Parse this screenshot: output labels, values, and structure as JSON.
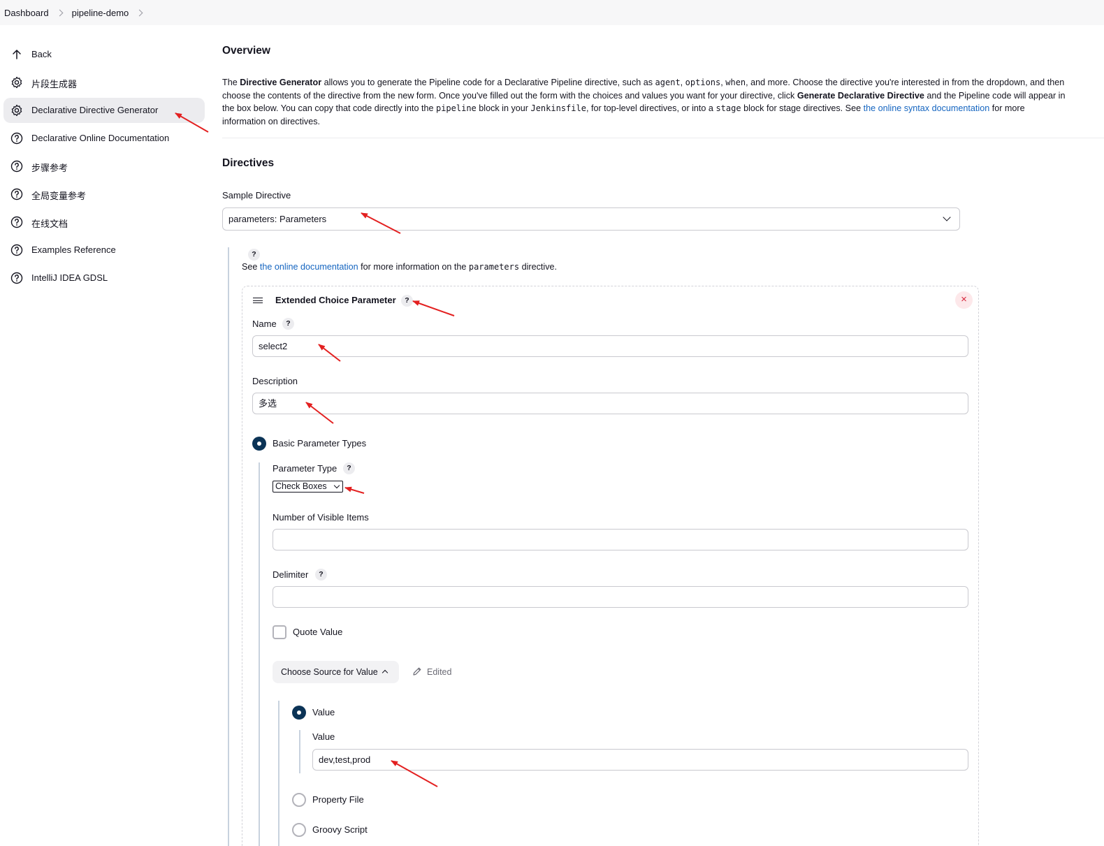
{
  "breadcrumb": {
    "items": [
      "Dashboard",
      "pipeline-demo"
    ]
  },
  "sidebar": {
    "items": [
      {
        "label": "Back",
        "icon": "arrow-up-icon",
        "active": false
      },
      {
        "label": "片段生成器",
        "icon": "gear-icon",
        "active": false
      },
      {
        "label": "Declarative Directive Generator",
        "icon": "gear-icon",
        "active": true
      },
      {
        "label": "Declarative Online Documentation",
        "icon": "help-circle-icon",
        "active": false
      },
      {
        "label": "步骤参考",
        "icon": "help-circle-icon",
        "active": false
      },
      {
        "label": "全局变量参考",
        "icon": "help-circle-icon",
        "active": false
      },
      {
        "label": "在线文档",
        "icon": "help-circle-icon",
        "active": false
      },
      {
        "label": "Examples Reference",
        "icon": "help-circle-icon",
        "active": false
      },
      {
        "label": "IntelliJ IDEA GDSL",
        "icon": "help-circle-icon",
        "active": false
      }
    ]
  },
  "overview": {
    "title": "Overview",
    "line1": {
      "t1": "The ",
      "b1": "Directive Generator",
      "t2": " allows you to generate the Pipeline code for a Declarative Pipeline directive, such as ",
      "c1": "agent",
      "t3": ", ",
      "c2": "options",
      "t4": ", ",
      "c3": "when",
      "t5": ", and more. Choose the directive you're interested in from the dropdown, and then"
    },
    "line2": {
      "t1": "choose the contents of the directive from the new form. Once you've filled out the form with the choices and values you want for your directive, click ",
      "b1": "Generate Declarative Directive",
      "t2": " and the Pipeline code will appear in"
    },
    "line3": {
      "t1": "the box below. You can copy that code directly into the ",
      "c1": "pipeline",
      "t2": " block in your ",
      "c2": "Jenkinsfile",
      "t3": ", for top-level directives, or into a ",
      "c3": "stage",
      "t4": " block for stage directives. See ",
      "link": "the online syntax documentation",
      "t5": " for more"
    },
    "line4": "information on directives."
  },
  "directives": {
    "title": "Directives",
    "sample_label": "Sample Directive",
    "sample_value": "parameters: Parameters",
    "help_glyph": "?",
    "doc_prefix": "See ",
    "doc_link": "the online documentation",
    "doc_middle": " for more information on the ",
    "doc_code": "parameters",
    "doc_suffix": " directive."
  },
  "parameter": {
    "title": "Extended Choice Parameter",
    "close_glyph": "×",
    "name_label": "Name",
    "name_value": "select2",
    "description_label": "Description",
    "description_value": "多选",
    "basic_types_label": "Basic Parameter Types",
    "type_label": "Parameter Type",
    "type_value": "Check Boxes",
    "visible_items_label": "Number of Visible Items",
    "visible_items_value": "",
    "delimiter_label": "Delimiter",
    "delimiter_value": "",
    "quote_value_label": "Quote Value",
    "quote_value_checked": false,
    "source_button": "Choose Source for Value",
    "edited_label": "Edited",
    "source_options": [
      "Value",
      "Property File",
      "Groovy Script"
    ],
    "source_selected": "Value",
    "value_label": "Value",
    "value_value": "dev,test,prod"
  },
  "colors": {
    "accent_link": "#1565c0",
    "radio_selected": "#0b3356",
    "annotation_arrow": "#e32020",
    "close_button": "#d6273c"
  }
}
